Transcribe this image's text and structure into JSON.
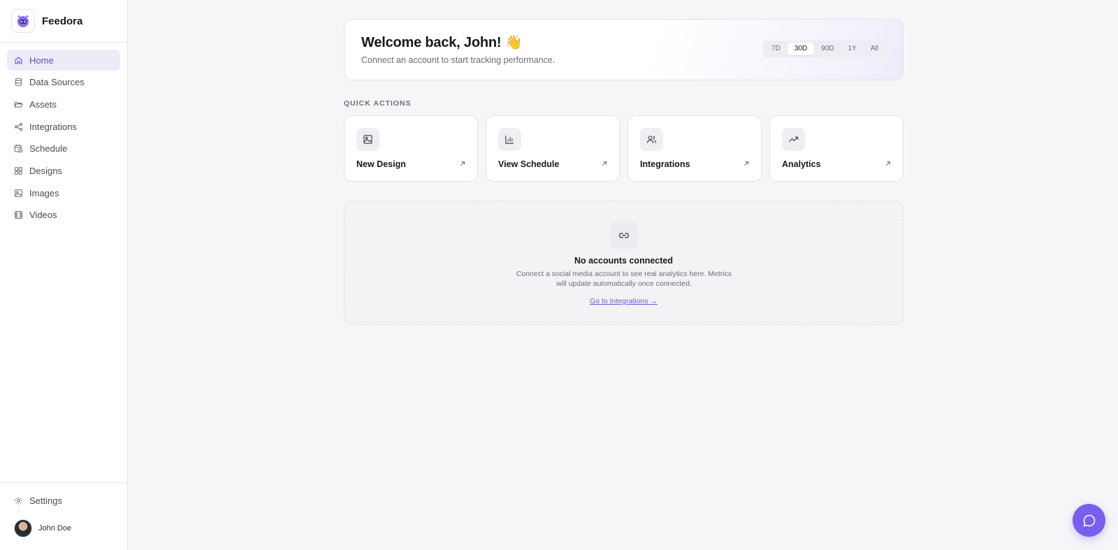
{
  "brand": {
    "name": "Feedora",
    "accent": "#7860ec"
  },
  "sidebar": {
    "items": [
      {
        "label": "Home",
        "icon": "home-icon",
        "active": true
      },
      {
        "label": "Data Sources",
        "icon": "database-icon"
      },
      {
        "label": "Assets",
        "icon": "folder-icon"
      },
      {
        "label": "Integrations",
        "icon": "share-icon"
      },
      {
        "label": "Schedule",
        "icon": "calendar-clock-icon"
      },
      {
        "label": "Designs",
        "icon": "grid-icon"
      },
      {
        "label": "Images",
        "icon": "image-icon"
      },
      {
        "label": "Videos",
        "icon": "film-icon"
      }
    ],
    "settings_label": "Settings",
    "user_name": "John Doe"
  },
  "welcome": {
    "title": "Welcome back, John! 👋",
    "subtitle": "Connect an account to start tracking performance.",
    "ranges": [
      "7D",
      "30D",
      "90D",
      "1Y",
      "All"
    ],
    "active_range": "30D"
  },
  "quick_actions": {
    "title": "QUICK ACTIONS",
    "cards": [
      {
        "label": "New Design",
        "icon": "image-icon"
      },
      {
        "label": "View Schedule",
        "icon": "bar-chart-icon"
      },
      {
        "label": "Integrations",
        "icon": "users-icon"
      },
      {
        "label": "Analytics",
        "icon": "trending-up-icon"
      }
    ]
  },
  "empty_state": {
    "icon": "link-icon",
    "title": "No accounts connected",
    "description": "Connect a social media account to see real analytics here. Metrics will update automatically once connected.",
    "link": "Go to Integrations →"
  },
  "chat": {
    "icon": "chat-icon"
  }
}
